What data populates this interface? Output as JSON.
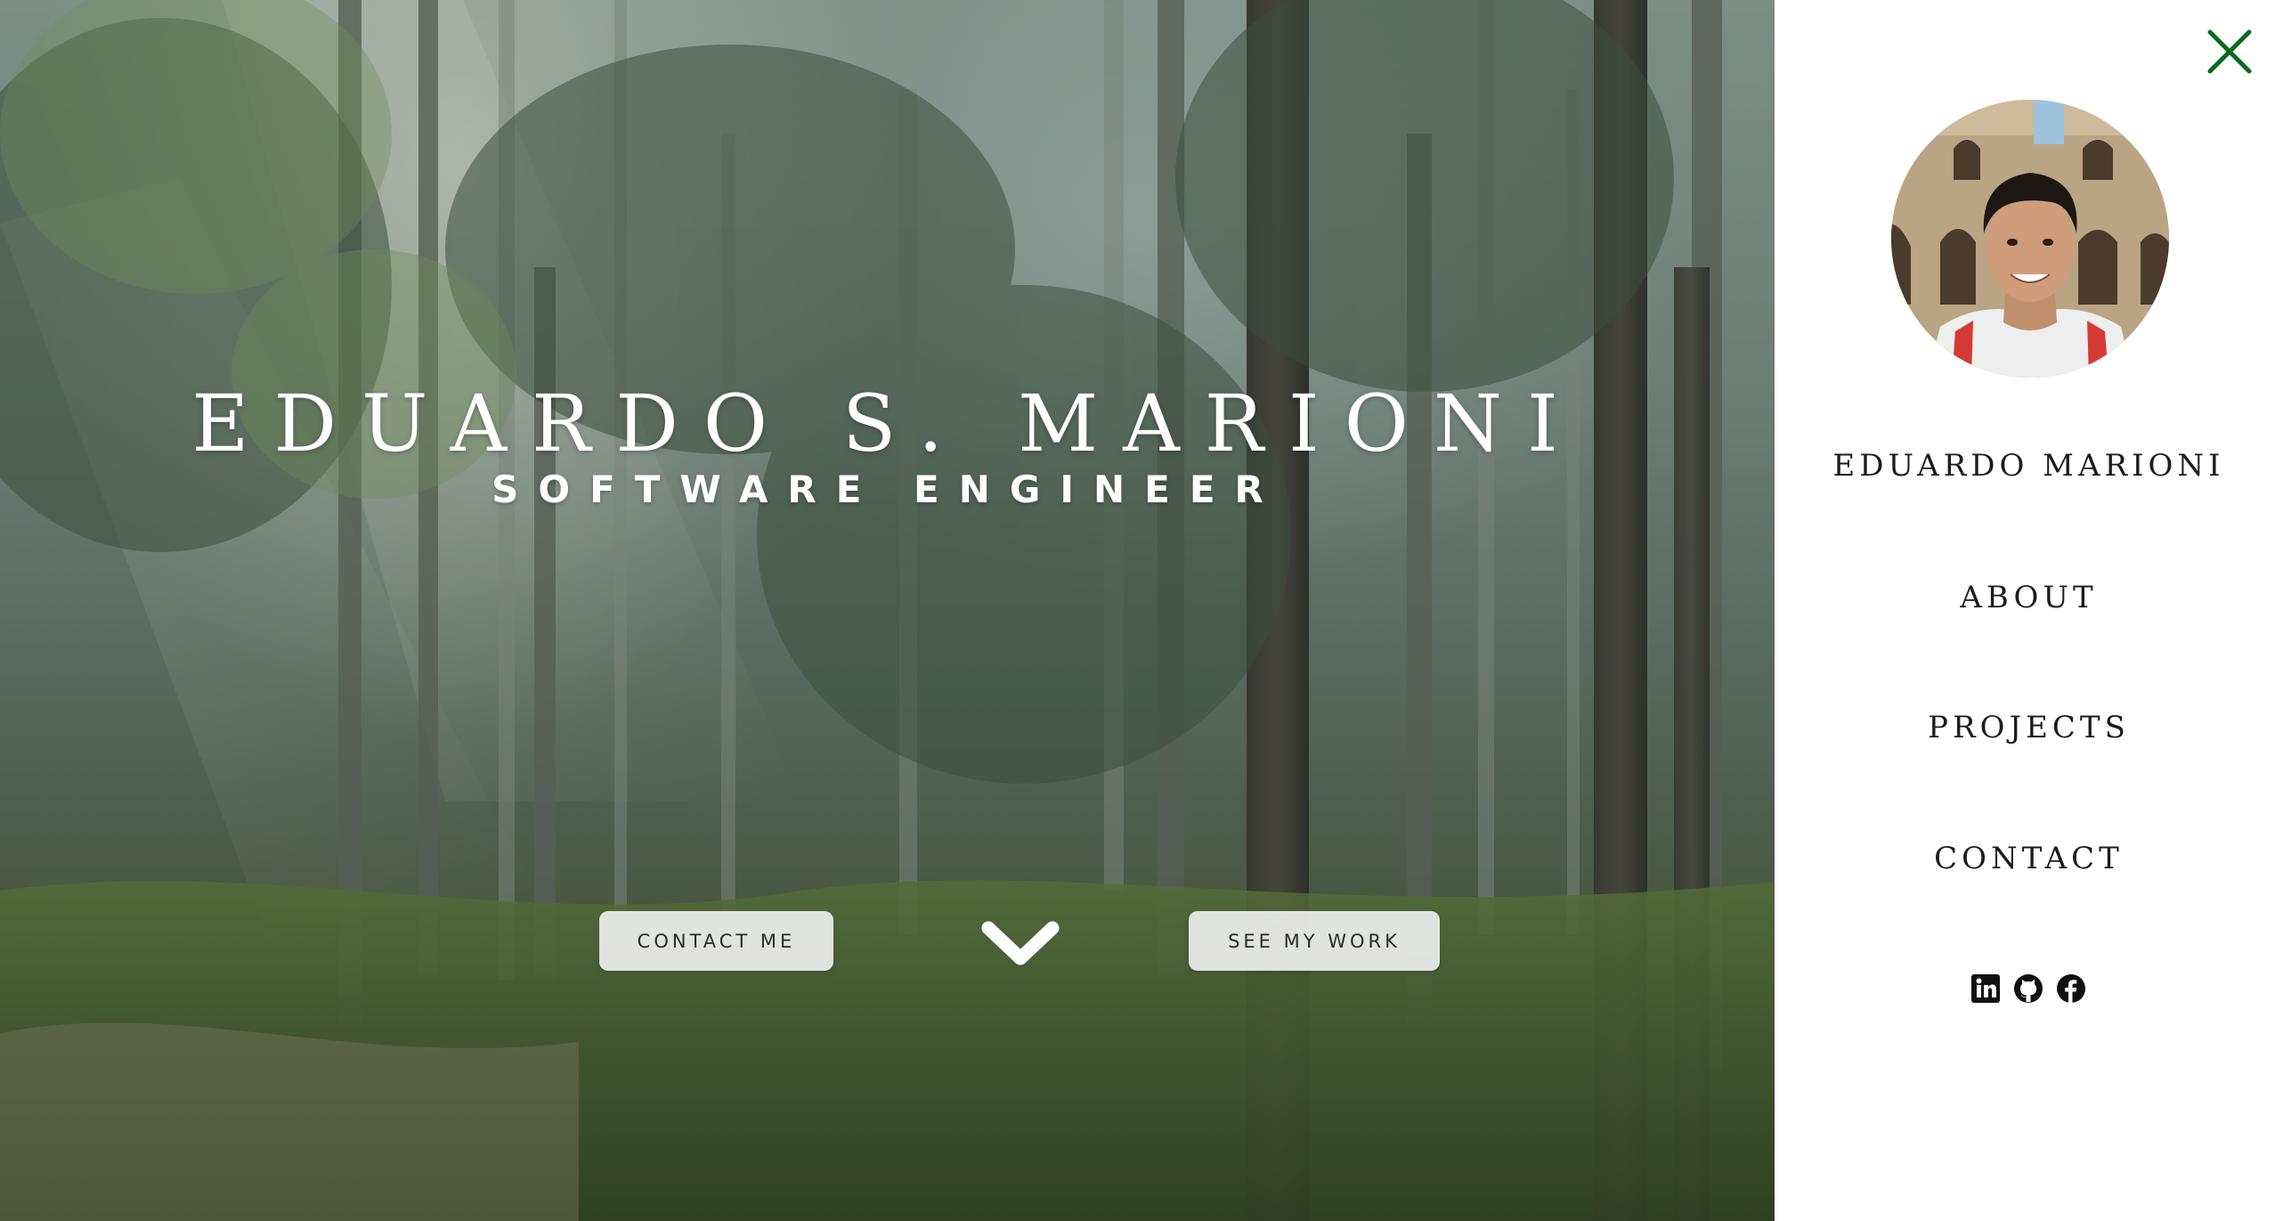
{
  "hero": {
    "title": "EDUARDO S. MARIONI",
    "subtitle": "SOFTWARE ENGINEER",
    "contact_button": "CONTACT ME",
    "work_button": "SEE MY WORK",
    "scroll_icon": "chevron-down-icon"
  },
  "menu": {
    "close_icon": "close-icon",
    "avatar": "profile-photo",
    "items": [
      {
        "label": "EDUARDO MARIONI"
      },
      {
        "label": "ABOUT"
      },
      {
        "label": "PROJECTS"
      },
      {
        "label": "CONTACT"
      }
    ],
    "socials": [
      {
        "icon": "linkedin-icon"
      },
      {
        "icon": "github-icon"
      },
      {
        "icon": "facebook-icon"
      }
    ]
  },
  "colors": {
    "accent_close": "#0a6b1e",
    "menu_text": "#1c1c1c",
    "button_bg": "#eeeeee",
    "hero_text": "#ffffff"
  }
}
